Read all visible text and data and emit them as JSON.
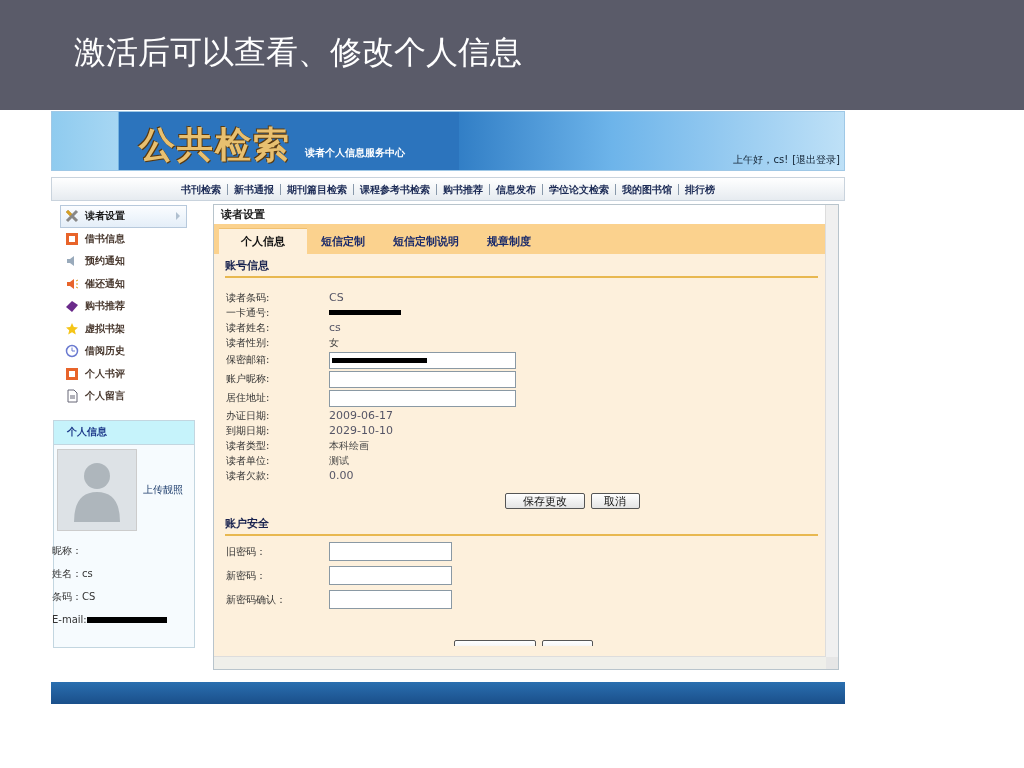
{
  "slide": {
    "title": "激活后可以查看、修改个人信息"
  },
  "banner": {
    "logo": "公共检索",
    "subtitle": "读者个人信息服务中心",
    "greeting": "上午好，cs!",
    "logout": "[退出登录]"
  },
  "nav": {
    "items": [
      "书刊检索",
      "新书通报",
      "期刊篇目检索",
      "课程参考书检索",
      "购书推荐",
      "信息发布",
      "学位论文检索",
      "我的图书馆",
      "排行榜"
    ]
  },
  "sidebar": {
    "items": [
      {
        "label": "读者设置",
        "selected": true
      },
      {
        "label": "借书信息",
        "selected": false
      },
      {
        "label": "预约通知",
        "selected": false
      },
      {
        "label": "催还通知",
        "selected": false
      },
      {
        "label": "购书推荐",
        "selected": false
      },
      {
        "label": "虚拟书架",
        "selected": false
      },
      {
        "label": "借阅历史",
        "selected": false
      },
      {
        "label": "个人书评",
        "selected": false
      },
      {
        "label": "个人留言",
        "selected": false
      }
    ],
    "profile": {
      "heading": "个人信息",
      "upload": "上传靓照",
      "fields": [
        {
          "label": "昵称：",
          "kind": "text"
        },
        {
          "label": "姓名：",
          "value": "cs",
          "kind": "text"
        },
        {
          "label": "条码：",
          "value": "CS",
          "kind": "text"
        },
        {
          "label": "E-mail:",
          "kind": "redacted"
        }
      ]
    }
  },
  "panel": {
    "title": "读者设置",
    "tabs": [
      {
        "label": "个人信息",
        "selected": true
      },
      {
        "label": "短信定制",
        "selected": false
      },
      {
        "label": "短信定制说明",
        "selected": false
      },
      {
        "label": "规章制度",
        "selected": false
      }
    ],
    "account": {
      "heading": "账号信息",
      "rows": [
        {
          "label": "读者条码:",
          "kind": "text",
          "value": "CS"
        },
        {
          "label": "一卡通号:",
          "kind": "redacted"
        },
        {
          "label": "读者姓名:",
          "kind": "text",
          "value": "cs"
        },
        {
          "label": "读者性别:",
          "kind": "text",
          "value": "女"
        },
        {
          "label": "保密邮箱:",
          "kind": "input",
          "redacted": true
        },
        {
          "label": "账户昵称:",
          "kind": "input",
          "redacted": false
        },
        {
          "label": "居住地址:",
          "kind": "input",
          "redacted": false
        },
        {
          "label": "办证日期:",
          "kind": "text",
          "value": "2009-06-17"
        },
        {
          "label": "到期日期:",
          "kind": "text",
          "value": "2029-10-10"
        },
        {
          "label": "读者类型:",
          "kind": "text",
          "value": "本科绘画"
        },
        {
          "label": "读者单位:",
          "kind": "text",
          "value": "测试"
        },
        {
          "label": "读者欠款:",
          "kind": "text",
          "value": "0.00"
        }
      ],
      "buttons": [
        "保存更改",
        "取消"
      ]
    },
    "security": {
      "heading": "账户安全",
      "rows": [
        {
          "label": "旧密码：",
          "kind": "input"
        },
        {
          "label": "新密码：",
          "kind": "input"
        },
        {
          "label": "新密码确认：",
          "kind": "input"
        }
      ]
    }
  }
}
